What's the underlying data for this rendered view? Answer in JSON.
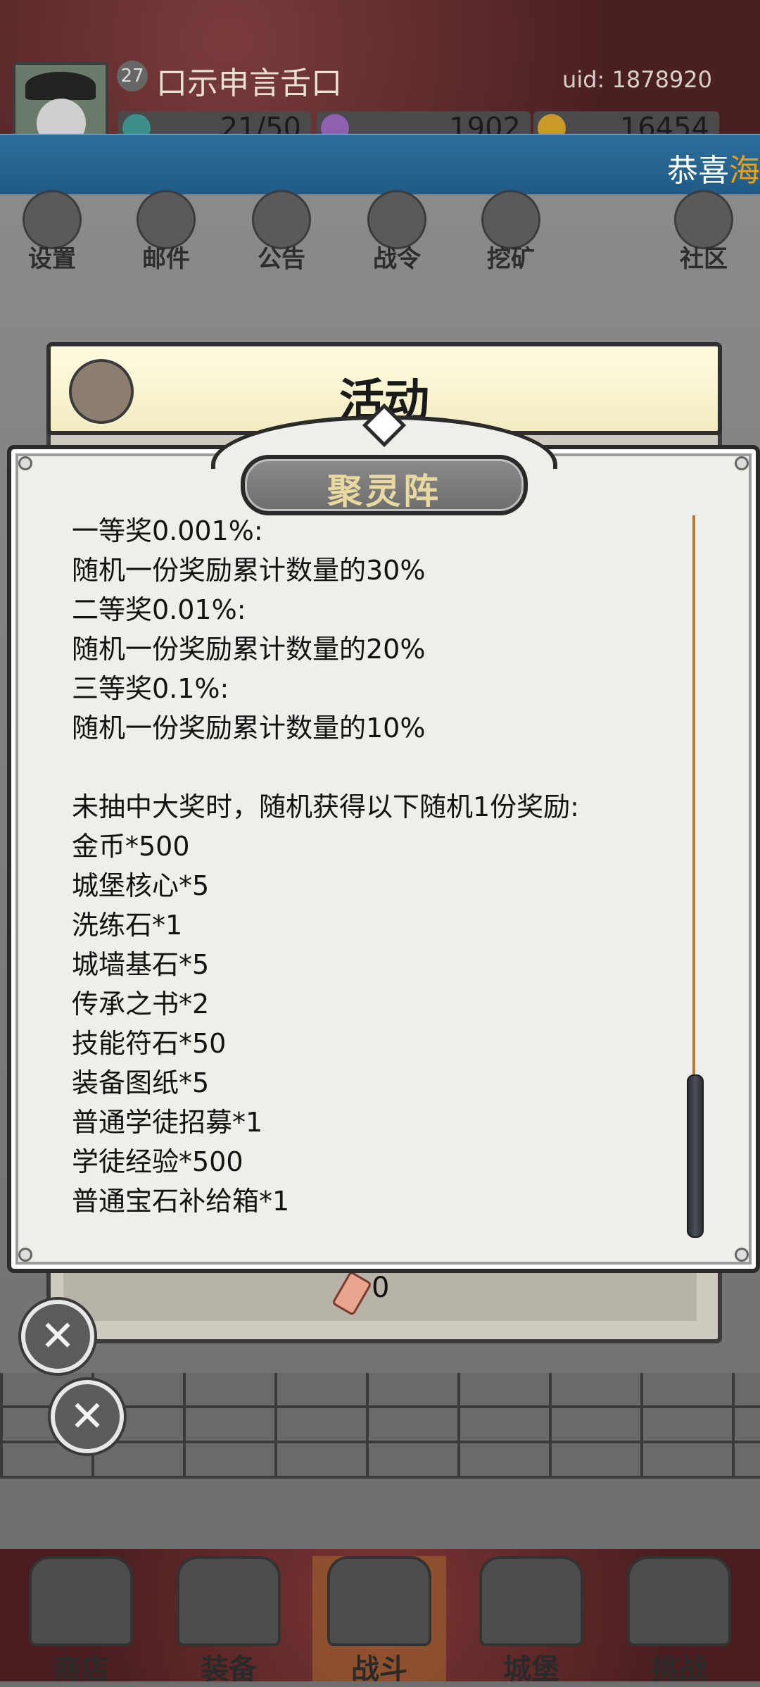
{
  "player": {
    "level": "27",
    "name": "口示申言舌口",
    "uid": "uid: 1878920",
    "resources": [
      "21/50",
      "1902",
      "16454"
    ]
  },
  "ticker": {
    "part1": "恭喜",
    "part2": "海"
  },
  "menu": [
    "设置",
    "邮件",
    "公告",
    "战令",
    "挖矿",
    "社区"
  ],
  "activity": {
    "title": "活动",
    "ticket_count": "0"
  },
  "dialog": {
    "title": "聚灵阵",
    "lines": [
      "一等奖0.001%:",
      "随机一份奖励累计数量的30%",
      "二等奖0.01%:",
      "随机一份奖励累计数量的20%",
      "三等奖0.1%:",
      "随机一份奖励累计数量的10%",
      "",
      "未抽中大奖时，随机获得以下随机1份奖励:",
      "金币*500",
      "城堡核心*5",
      "洗练石*1",
      "城墙基石*5",
      "传承之书*2",
      "技能符石*50",
      "装备图纸*5",
      "普通学徒招募*1",
      "学徒经验*500",
      "普通宝石补给箱*1"
    ]
  },
  "bottom_nav": [
    "商店",
    "装备",
    "战斗",
    "城堡",
    "挑战"
  ],
  "colors": {
    "dialog_title": "#e8d9a0",
    "ticker_highlight": "#f0a010",
    "scroll_track": "#b07a3a"
  }
}
